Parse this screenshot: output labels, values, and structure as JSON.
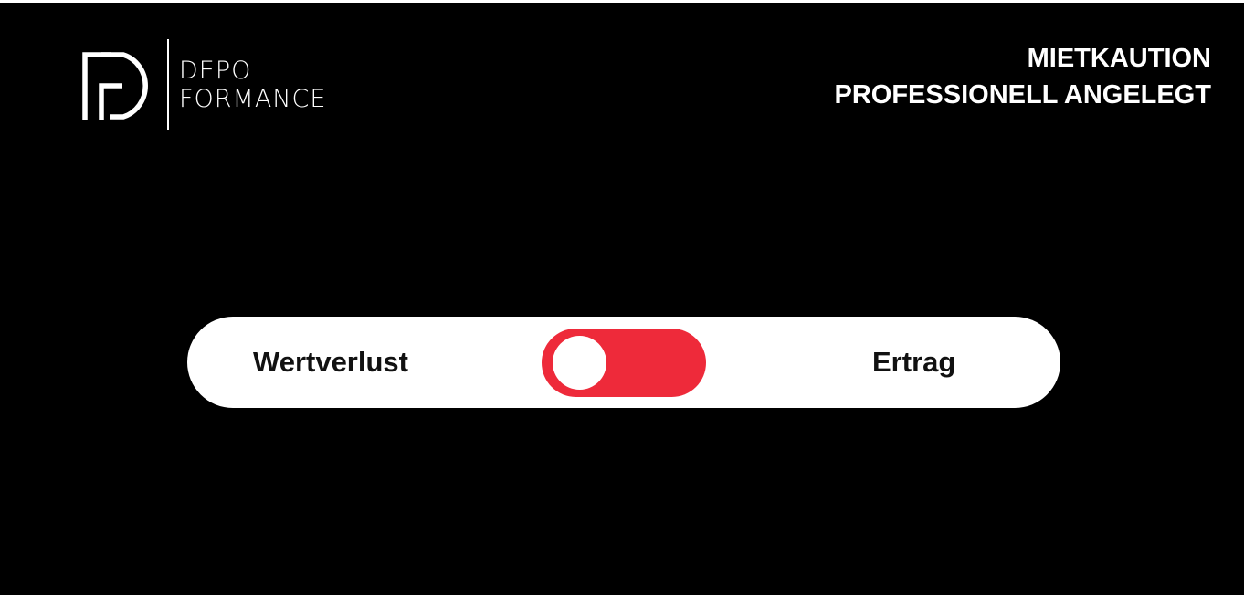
{
  "brand": {
    "line1": "DEPO",
    "line2": "FORMANCE",
    "logo_icon": "df-monogram-icon"
  },
  "tagline": {
    "line1": "MIETKAUTION",
    "line2": "PROFESSIONELL ANGELEGT"
  },
  "toggle": {
    "left_label": "Wertverlust",
    "right_label": "Ertrag",
    "state": "left",
    "active_color": "#ee2a3a"
  },
  "colors": {
    "background": "#000000",
    "text_light": "#ffffff",
    "pill": "#ffffff"
  }
}
